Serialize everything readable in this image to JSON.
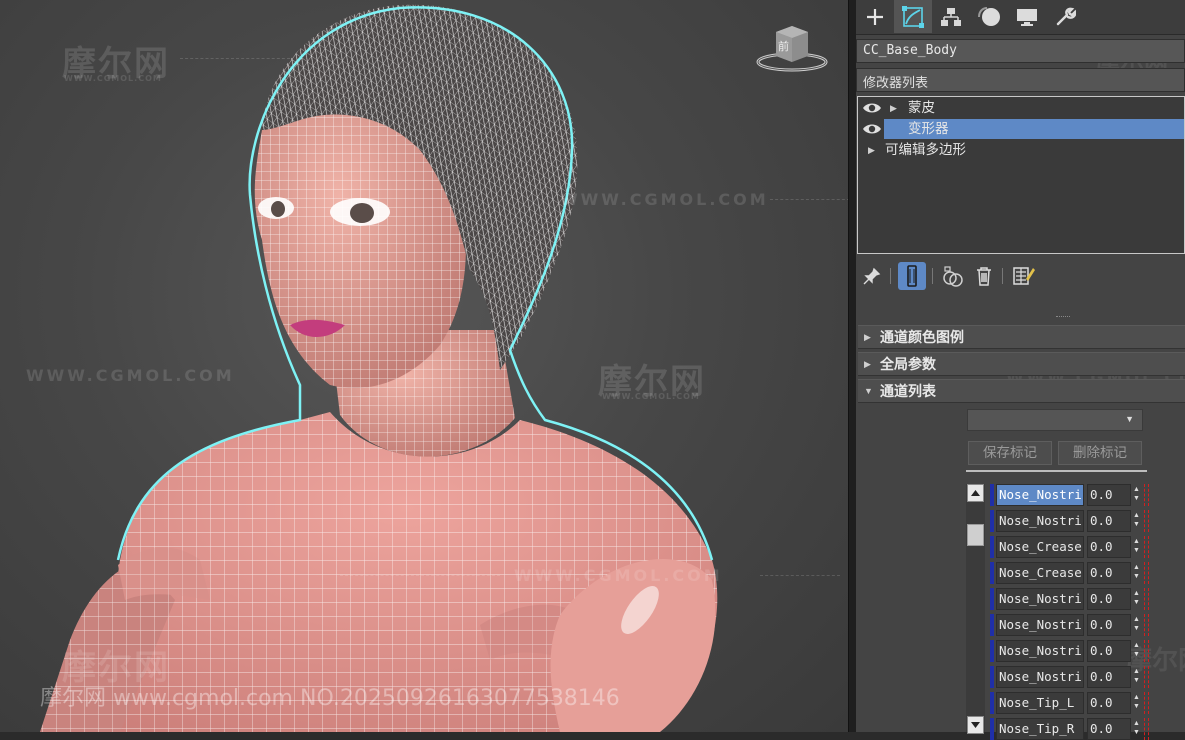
{
  "viewport": {
    "watermarks": {
      "logo": "摩尔网",
      "url_small": "WWW.CGMOL.COM",
      "url": "WWW.CGMOL.COM",
      "bottom_line": "摩尔网 www.cgmol.com NO.20250926163077538146"
    },
    "viewcube_label": "前"
  },
  "command_panel": {
    "tabs": [
      {
        "name": "create",
        "icon": "plus-icon"
      },
      {
        "name": "modify",
        "icon": "modify-icon"
      },
      {
        "name": "hierarchy",
        "icon": "hierarchy-icon"
      },
      {
        "name": "motion",
        "icon": "motion-icon"
      },
      {
        "name": "display",
        "icon": "display-icon"
      },
      {
        "name": "utilities",
        "icon": "wrench-icon"
      }
    ],
    "object_name": "CC_Base_Body",
    "modifier_list_label": "修改器列表",
    "modifier_stack": [
      {
        "label": "蒙皮",
        "visible": true,
        "expandable": true,
        "selected": false
      },
      {
        "label": "变形器",
        "visible": true,
        "expandable": false,
        "selected": true
      },
      {
        "label": "可编辑多边形",
        "visible": false,
        "expandable": true,
        "selected": false
      }
    ],
    "rollouts": [
      {
        "title": "通道颜色图例",
        "expanded": false
      },
      {
        "title": "全局参数",
        "expanded": false
      },
      {
        "title": "通道列表",
        "expanded": true
      }
    ],
    "channel_list": {
      "dropdown_value": "",
      "save_marker_label": "保存标记",
      "delete_marker_label": "删除标记",
      "channels": [
        {
          "name": "Nose_Nostri",
          "value": "0.0",
          "selected": true
        },
        {
          "name": "Nose_Nostri",
          "value": "0.0",
          "selected": false
        },
        {
          "name": "Nose_Crease",
          "value": "0.0",
          "selected": false
        },
        {
          "name": "Nose_Crease",
          "value": "0.0",
          "selected": false
        },
        {
          "name": "Nose_Nostri",
          "value": "0.0",
          "selected": false
        },
        {
          "name": "Nose_Nostri",
          "value": "0.0",
          "selected": false
        },
        {
          "name": "Nose_Nostri",
          "value": "0.0",
          "selected": false
        },
        {
          "name": "Nose_Nostri",
          "value": "0.0",
          "selected": false
        },
        {
          "name": "Nose_Tip_L",
          "value": "0.0",
          "selected": false
        },
        {
          "name": "Nose_Tip_R",
          "value": "0.0",
          "selected": false
        }
      ]
    }
  },
  "colors": {
    "selection_blue": "#5e89c6",
    "channel_color": "#1f2fa8",
    "mesh_skin": "#e39a95",
    "wire_white": "#ffffff",
    "selection_outline": "#7ef2f5"
  }
}
